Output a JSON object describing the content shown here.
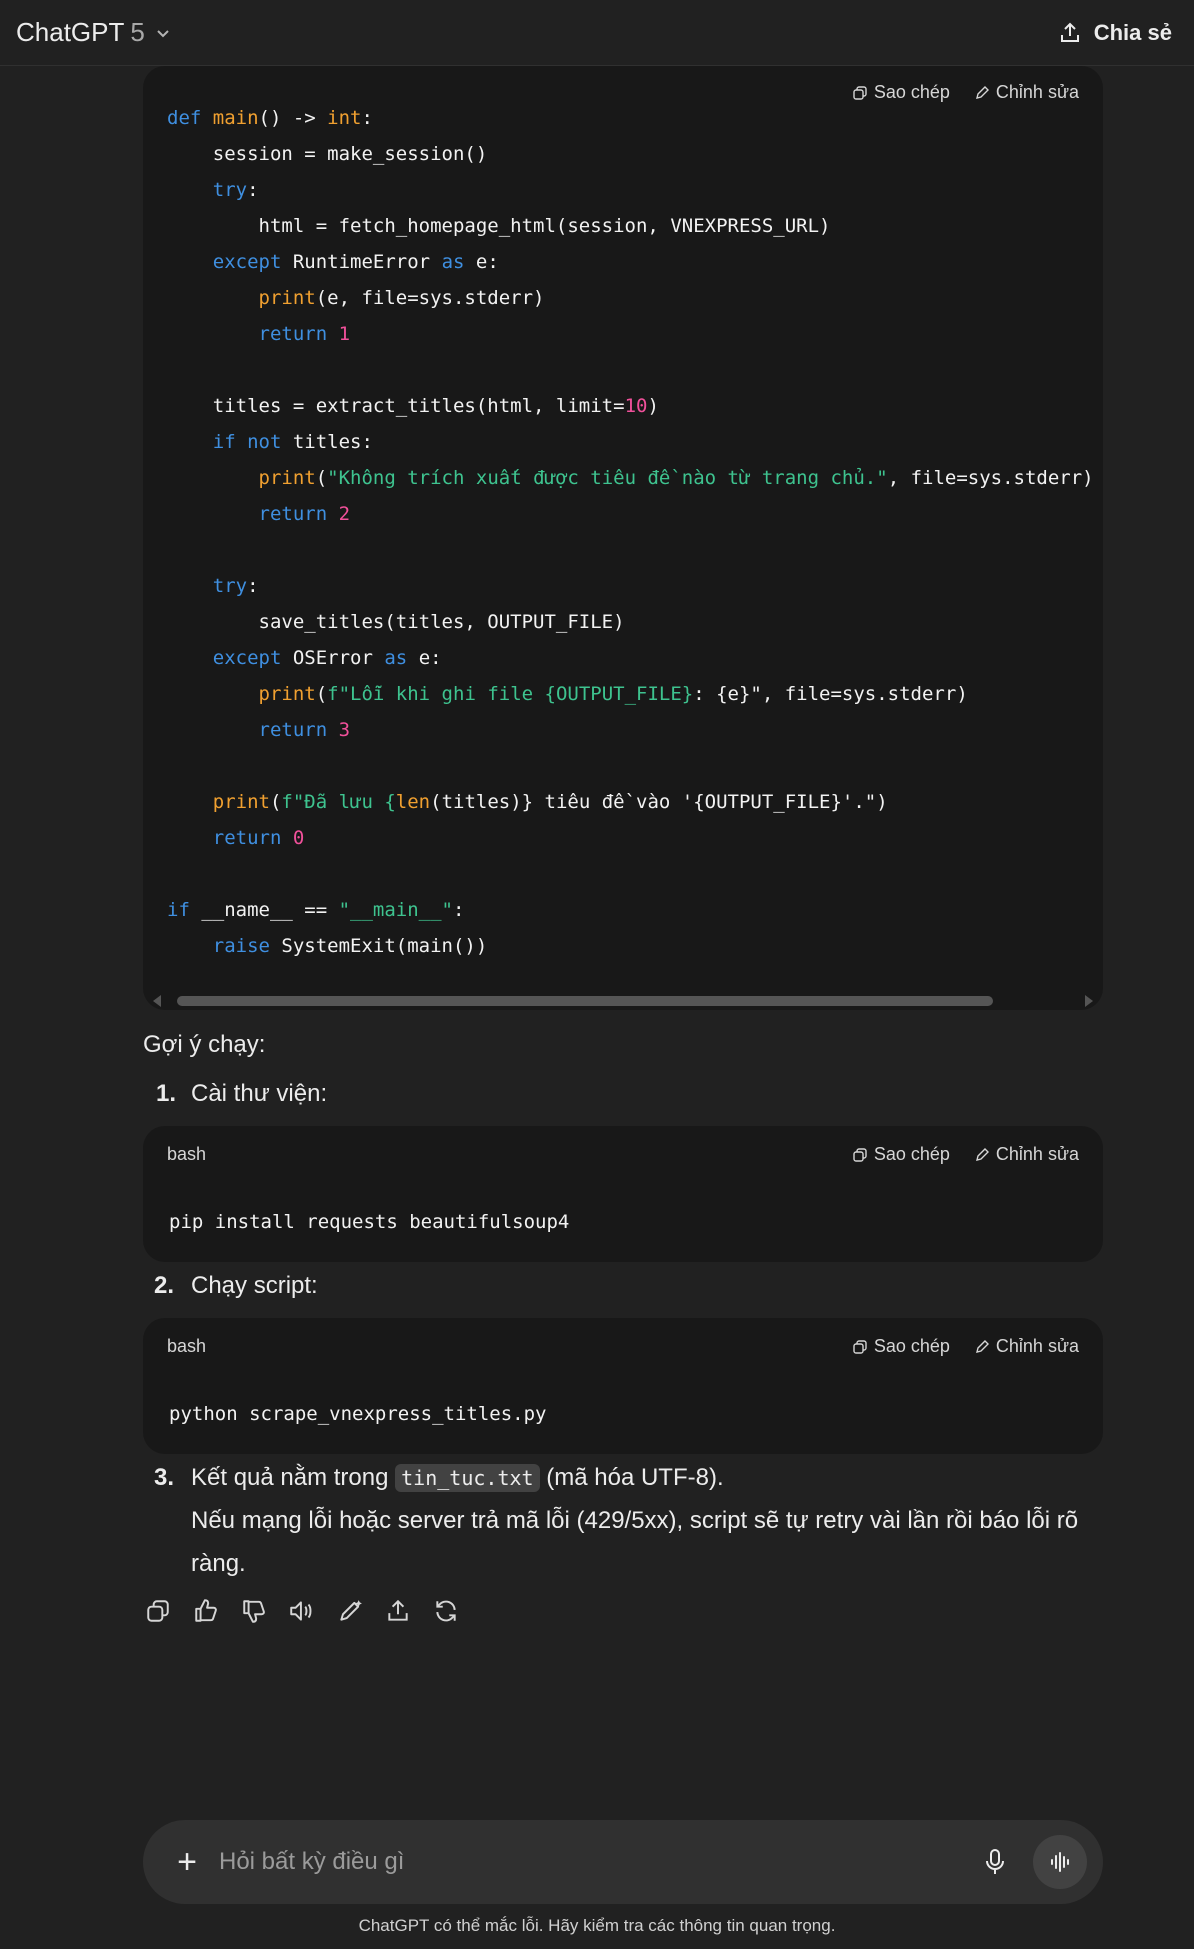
{
  "header": {
    "model_name": "ChatGPT",
    "model_version": "5",
    "share_label": "Chia sẻ"
  },
  "code_actions": {
    "copy_label": "Sao chép",
    "edit_label": "Chỉnh sửa"
  },
  "main_code": {
    "lines": [
      [
        [
          "kw",
          "def "
        ],
        [
          "fn",
          "main"
        ],
        [
          "",
          "() -> "
        ],
        [
          "fn",
          "int"
        ],
        [
          "",
          ":"
        ]
      ],
      [
        [
          "",
          "    session = make_session()"
        ]
      ],
      [
        [
          "kw",
          "    try"
        ],
        [
          "",
          ":"
        ]
      ],
      [
        [
          "",
          "        html = fetch_homepage_html(session, VNEXPRESS_URL)"
        ]
      ],
      [
        [
          "kw",
          "    except "
        ],
        [
          "",
          "RuntimeError "
        ],
        [
          "kw",
          "as"
        ],
        [
          "",
          " e:"
        ]
      ],
      [
        [
          "fn",
          "        print"
        ],
        [
          "",
          "(e, file=sys.stderr)"
        ]
      ],
      [
        [
          "kw",
          "        return "
        ],
        [
          "num",
          "1"
        ]
      ],
      [
        [
          "",
          ""
        ]
      ],
      [
        [
          "",
          "    titles = extract_titles(html, limit="
        ],
        [
          "num",
          "10"
        ],
        [
          "",
          ")"
        ]
      ],
      [
        [
          "kw",
          "    if not "
        ],
        [
          "",
          "titles:"
        ]
      ],
      [
        [
          "fn",
          "        print"
        ],
        [
          "",
          "("
        ],
        [
          "str",
          "\"Không trích xuất được tiêu đề nào từ trang chủ.\""
        ],
        [
          "",
          ", file=sys.stderr)"
        ]
      ],
      [
        [
          "kw",
          "        return "
        ],
        [
          "num",
          "2"
        ]
      ],
      [
        [
          "",
          ""
        ]
      ],
      [
        [
          "kw",
          "    try"
        ],
        [
          "",
          ":"
        ]
      ],
      [
        [
          "",
          "        save_titles(titles, OUTPUT_FILE)"
        ]
      ],
      [
        [
          "kw",
          "    except "
        ],
        [
          "",
          "OSError "
        ],
        [
          "kw",
          "as"
        ],
        [
          "",
          " e:"
        ]
      ],
      [
        [
          "fn",
          "        print"
        ],
        [
          "",
          "("
        ],
        [
          "str",
          "f\"Lỗi khi ghi file {OUTPUT_FILE}"
        ],
        [
          "",
          ": {e}\", file=sys.stderr)"
        ]
      ],
      [
        [
          "kw",
          "        return "
        ],
        [
          "num",
          "3"
        ]
      ],
      [
        [
          "",
          ""
        ]
      ],
      [
        [
          "fn",
          "    print"
        ],
        [
          "",
          "("
        ],
        [
          "str",
          "f\"Đã lưu {"
        ],
        [
          "fn",
          "len"
        ],
        [
          "",
          "(titles)} tiêu đề vào '{OUTPUT_FILE}'.\")"
        ]
      ],
      [
        [
          "kw",
          "    return "
        ],
        [
          "num",
          "0"
        ]
      ],
      [
        [
          "",
          ""
        ]
      ],
      [
        [
          "kw",
          "if "
        ],
        [
          "",
          "__name__ == "
        ],
        [
          "str",
          "\"__main__\""
        ],
        [
          "",
          ":"
        ]
      ],
      [
        [
          "kw",
          "    raise "
        ],
        [
          "",
          "SystemExit(main())"
        ]
      ]
    ]
  },
  "message": {
    "suggest_heading": "Gợi ý chạy:",
    "step1_num": "1.",
    "step1_text": "Cài thư viện:",
    "step1_lang": "bash",
    "step1_code": "pip install requests beautifulsoup4",
    "step2_num": "2.",
    "step2_text": "Chạy script:",
    "step2_lang": "bash",
    "step2_code": "python scrape_vnexpress_titles.py",
    "step3_num": "3.",
    "step3_before": "Kết quả nằm trong",
    "step3_code": "tin_tuc.txt",
    "step3_after": "(mã hóa UTF-8).",
    "step3_line2": "Nếu mạng lỗi hoặc server trả mã lỗi (429/5xx), script sẽ tự retry vài lần rồi báo lỗi rõ",
    "step3_line3": "ràng."
  },
  "composer": {
    "placeholder": "Hỏi bất kỳ điều gì"
  },
  "footer_note": "ChatGPT có thể mắc lỗi. Hãy kiểm tra các thông tin quan trọng.",
  "icons": [
    "chevron-down-icon",
    "share-icon",
    "copy-icon",
    "edit-icon",
    "thumbs-up-icon",
    "thumbs-down-icon",
    "read-aloud-icon",
    "edit-message-icon",
    "share-message-icon",
    "regenerate-icon",
    "plus-icon",
    "mic-icon",
    "voice-mode-icon"
  ]
}
